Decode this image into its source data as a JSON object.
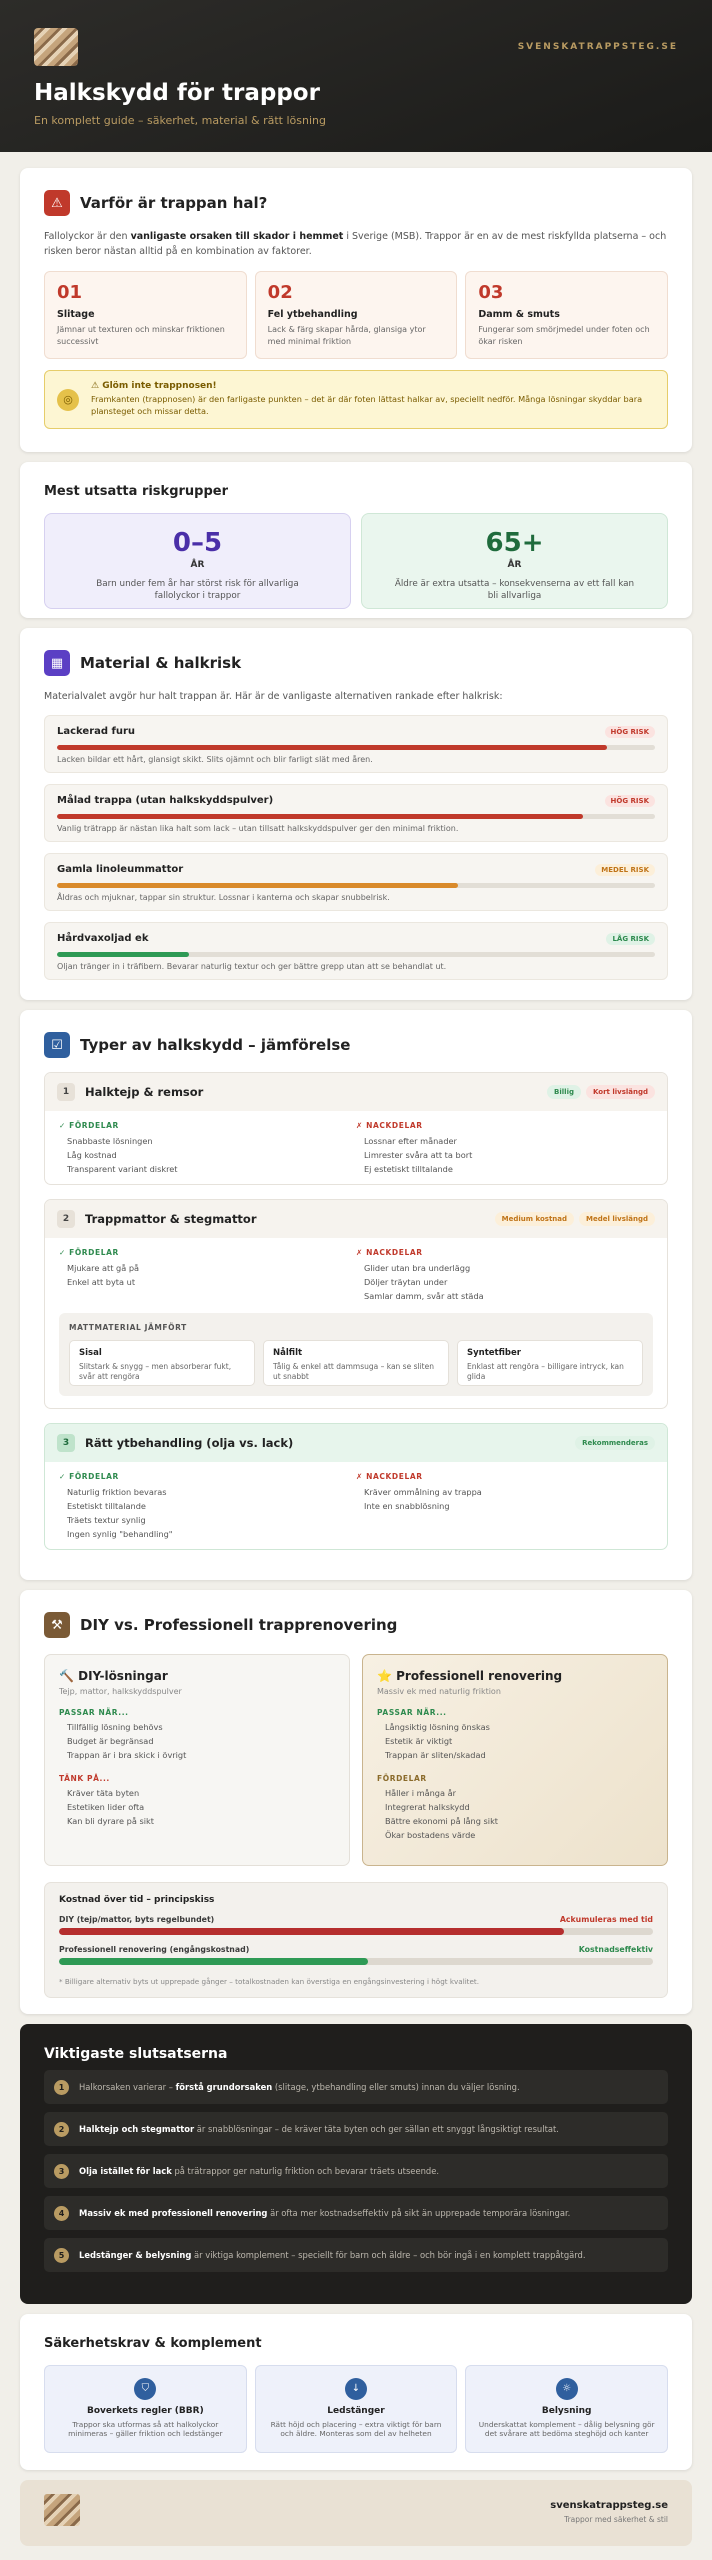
{
  "header": {
    "brand": "SVENSKATRAPPSTEG.SE",
    "title": "Halkskydd för trappor",
    "subtitle": "En komplett guide – säkerhet, material & rätt lösning"
  },
  "why": {
    "icon": "warning-icon",
    "title": "Varför är trappan hal?",
    "intro_a": "Fallolyckor är den ",
    "intro_b": "vanligaste orsaken till skador i hemmet",
    "intro_c": " i Sverige (MSB). Trappor är en av de mest riskfyllda platserna – och risken beror nästan alltid på en kombination av faktorer.",
    "causes": [
      {
        "n": "01",
        "h": "Slitage",
        "t": "Jämnar ut texturen och minskar friktionen successivt"
      },
      {
        "n": "02",
        "h": "Fel ytbehandling",
        "t": "Lack & färg skapar hårda, glansiga ytor med minimal friktion"
      },
      {
        "n": "03",
        "h": "Damm & smuts",
        "t": "Fungerar som smörjmedel under foten och ökar risken"
      }
    ],
    "tip_icon": "target-icon",
    "tip_title": "⚠ Glöm inte trappnosen!",
    "tip_text": "Framkanten (trappnosen) är den farligaste punkten – det är där foten lättast halkar av, speciellt nedför. Många lösningar skyddar bara plansteget och missar detta."
  },
  "groups": {
    "title": "Mest utsatta riskgrupper",
    "items": [
      {
        "big": "0–5",
        "unit": "ÅR",
        "t": "Barn under fem år har störst risk för allvarliga fallolyckor i trappor",
        "color": "#4a2fa8",
        "bg": "#f0eefb",
        "border": "#d6d0f0"
      },
      {
        "big": "65+",
        "unit": "ÅR",
        "t": "Äldre är extra utsatta – konsekvenserna av ett fall kan bli allvarliga",
        "color": "#1f6b3c",
        "bg": "#eaf6ee",
        "border": "#cfe7d6"
      }
    ]
  },
  "material": {
    "icon": "layout-icon",
    "title": "Material & halkrisk",
    "intro": "Materialvalet avgör hur halt trappan är. Här är de vanligaste alternativen rankade efter halkrisk:",
    "items": [
      {
        "h": "Lackerad furu",
        "badge": "HÖG RISK",
        "level": 0.92,
        "color": "#c0392b",
        "bbg": "#fbe3e0",
        "bfg": "#c0392b",
        "t": "Lacken bildar ett hårt, glansigt skikt. Slits ojämnt och blir farligt slät med åren."
      },
      {
        "h": "Målad trappa (utan halkskyddspulver)",
        "badge": "HÖG RISK",
        "level": 0.88,
        "color": "#c0392b",
        "bbg": "#fbe3e0",
        "bfg": "#c0392b",
        "t": "Vanlig trätrapp är nästan lika halt som lack – utan tillsatt halkskyddspulver ger den minimal friktion."
      },
      {
        "h": "Gamla linoleummattor",
        "badge": "MEDEL RISK",
        "level": 0.67,
        "color": "#d98a2b",
        "bbg": "#fcefd9",
        "bfg": "#c07418",
        "t": "Åldras och mjuknar, tappar sin struktur. Lossnar i kanterna och skapar snubbelrisk."
      },
      {
        "h": "Hårdvaxoljad ek",
        "badge": "LÅG RISK",
        "level": 0.22,
        "color": "#2e9a55",
        "bbg": "#dff2e6",
        "bfg": "#2e8a4e",
        "t": "Oljan tränger in i träfibern. Bevarar naturlig textur och ger bättre grepp utan att se behandlat ut."
      }
    ]
  },
  "types": {
    "icon": "checkbox-icon",
    "title": "Typer av halkskydd – jämförelse",
    "pros_label": "✓ FÖRDELAR",
    "cons_label": "✗ NACKDELAR",
    "items": [
      {
        "n": "1",
        "h": "Halktejp & remsor",
        "tags": [
          {
            "t": "Billig",
            "bg": "#dff2e6",
            "fg": "#2e8a4e"
          },
          {
            "t": "Kort livslängd",
            "bg": "#fbe3e0",
            "fg": "#c0392b"
          }
        ],
        "pros": [
          "Snabbaste lösningen",
          "Låg kostnad",
          "Transparent variant diskret"
        ],
        "cons": [
          "Lossnar efter månader",
          "Limrester svåra att ta bort",
          "Ej estetiskt tilltalande"
        ]
      },
      {
        "n": "2",
        "h": "Trappmattor & stegmattor",
        "tags": [
          {
            "t": "Medium kostnad",
            "bg": "#fcefd9",
            "fg": "#c07418"
          },
          {
            "t": "Medel livslängd",
            "bg": "#fcefd9",
            "fg": "#c07418"
          }
        ],
        "pros": [
          "Mjukare att gå på",
          "Enkel att byta ut"
        ],
        "cons": [
          "Glider utan bra underlägg",
          "Döljer träytan under",
          "Samlar damm, svår att städa"
        ]
      },
      {
        "n": "3",
        "h": "Rätt ytbehandling (olja vs. lack)",
        "tags": [
          {
            "t": "Rekommenderas",
            "bg": "#dff2e6",
            "fg": "#2e8a4e"
          }
        ],
        "pros": [
          "Naturlig friktion bevaras",
          "Estetiskt tilltalande",
          "Träets textur synlig",
          "Ingen synlig \"behandling\""
        ],
        "cons": [
          "Kräver ommålning av trappa",
          "Inte en snabblösning"
        ]
      }
    ],
    "mat_title": "MATTMATERIAL JÄMFÖRT",
    "mats": [
      {
        "h": "Sisal",
        "t": "Slitstark & snygg – men absorberar fukt, svår att rengöra"
      },
      {
        "h": "Nålfilt",
        "t": "Tålig & enkel att dammsuga – kan se sliten ut snabbt"
      },
      {
        "h": "Syntetfiber",
        "t": "Enklast att rengöra – billigare intryck, kan glida"
      }
    ]
  },
  "diy": {
    "icon": "hammer-icon",
    "title": "DIY vs. Professionell trapprenovering",
    "a": {
      "h": "🔨 DIY-lösningar",
      "s": "Tejp, mattor, halkskyddspulver",
      "l1": "PASSAR NÄR...",
      "i1": [
        "Tillfällig lösning behövs",
        "Budget är begränsad",
        "Trappan är i bra skick i övrigt"
      ],
      "l2": "TÄNK PÅ...",
      "i2": [
        "Kräver täta byten",
        "Estetiken lider ofta",
        "Kan bli dyrare på sikt"
      ]
    },
    "b": {
      "h": "⭐ Professionell renovering",
      "s": "Massiv ek med naturlig friktion",
      "l1": "PASSAR NÄR...",
      "i1": [
        "Långsiktig lösning önskas",
        "Estetik är viktigt",
        "Trappan är sliten/skadad"
      ],
      "l2": "FÖRDELAR",
      "i2": [
        "Håller i många år",
        "Integrerat halkskydd",
        "Bättre ekonomi på lång sikt",
        "Ökar bostadens värde"
      ]
    },
    "cost_title": "Kostnad över tid – principskiss",
    "costs": [
      {
        "l": "DIY (tejp/mattor, byts regelbundet)",
        "r": "Ackumuleras med tid",
        "level": 0.85,
        "color": "#b52e2e",
        "fg": "#c0392b"
      },
      {
        "l": "Professionell renovering (engångskostnad)",
        "r": "Kostnadseffektiv",
        "level": 0.52,
        "color": "#2e9a55",
        "fg": "#2e8a4e"
      }
    ],
    "cost_note": "* Billigare alternativ byts ut upprepade gånger – totalkostnaden kan överstiga en engångsinvestering i högt kvalitet."
  },
  "conclusions": {
    "title": "Viktigaste slutsatserna",
    "items": [
      {
        "n": "1",
        "a": "Halkorsaken varierar – ",
        "b": "förstå grundorsaken",
        "c": " (slitage, ytbehandling eller smuts) innan du väljer lösning."
      },
      {
        "n": "2",
        "a": "",
        "b": "Halktejp och stegmattor",
        "c": " är snabblösningar – de kräver täta byten och ger sällan ett snyggt långsiktigt resultat."
      },
      {
        "n": "3",
        "a": "",
        "b": "Olja istället för lack",
        "c": " på trätrappor ger naturlig friktion och bevarar träets utseende."
      },
      {
        "n": "4",
        "a": "",
        "b": "Massiv ek med professionell renovering",
        "c": " är ofta mer kostnadseffektiv på sikt än upprepade temporära lösningar."
      },
      {
        "n": "5",
        "a": "",
        "b": "Ledstänger & belysning",
        "c": " är viktiga komplement – speciellt för barn och äldre – och bör ingå i en komplett trappåtgärd."
      }
    ]
  },
  "safety": {
    "title": "Säkerhetskrav & komplement",
    "items": [
      {
        "icon": "shield-icon",
        "h": "Boverkets regler (BBR)",
        "t": "Trappor ska utformas så att halkolyckor minimeras – gäller friktion och ledstänger"
      },
      {
        "icon": "arrow-down-icon",
        "h": "Ledstänger",
        "t": "Rätt höjd och placering – extra viktigt för barn och äldre. Monteras som del av helheten"
      },
      {
        "icon": "light-icon",
        "h": "Belysning",
        "t": "Underskattat komplement – dålig belysning gör det svårare att bedöma steghöjd och kanter"
      }
    ]
  },
  "footer": {
    "name": "svenskatrappsteg.se",
    "tagline": "Trappor med säkerhet & stil"
  }
}
